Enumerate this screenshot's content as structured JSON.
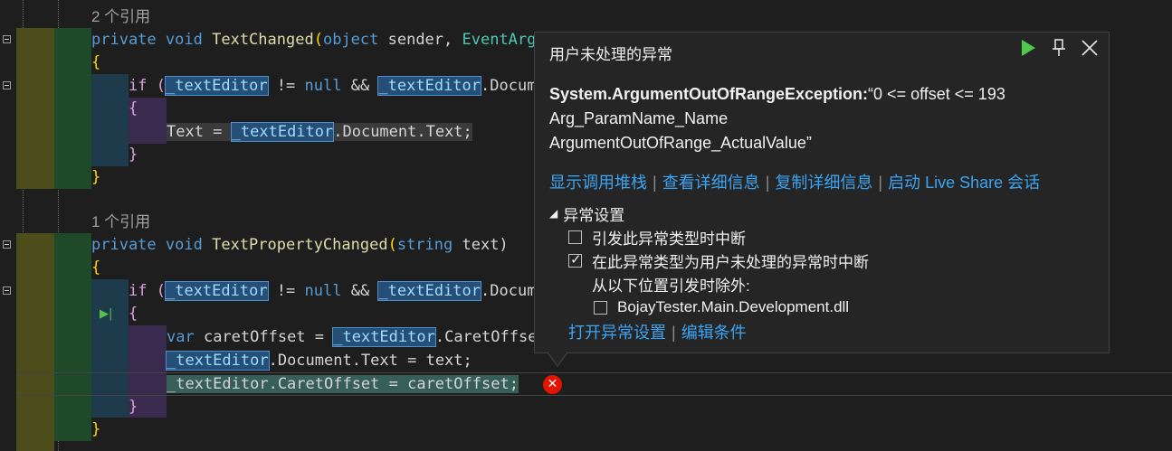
{
  "code": {
    "lines": [
      {
        "refs": "2 个引用"
      },
      {
        "sig1_kw1": "private",
        "sig1_kw2": "void",
        "sig1_fn": "TextChanged",
        "sig1_rest_a": "(",
        "sig1_kw3": "object",
        "sig1_rest_b": " sender, ",
        "sig1_type": "EventArg"
      },
      {
        "brace": "{"
      },
      {
        "if_kw": "if",
        "paren": " (",
        "ident": "_textEditor",
        "op": " != ",
        "null_kw": "null",
        "and": " && ",
        "ident2": "_textEditor",
        "tail": ".Docum"
      },
      {
        "brace": "{"
      },
      {
        "lhs": "Text = ",
        "ident": "_textEditor",
        "tail": ".Document.Text;"
      },
      {
        "brace": "}"
      },
      {
        "brace": "}"
      },
      {
        "refs": "1 个引用"
      },
      {
        "kw1": "private",
        "kw2": "void",
        "fn": "TextPropertyChanged",
        "p1": "(",
        "kw3": "string",
        "p2": " text)"
      },
      {
        "brace": "{"
      },
      {
        "if_kw": "if",
        "paren": " (",
        "ident": "_textEditor",
        "op": " != ",
        "null_kw": "null",
        "and": " && ",
        "ident2": "_textEditor",
        "tail": ".Docum"
      },
      {
        "brace": "{"
      },
      {
        "var_kw": "var",
        "mid": " caretOffset = ",
        "ident": "_textEditor",
        "tail": ".CaretOffse"
      },
      {
        "ident": "_textEditor",
        "tail": ".Document.Text = text;"
      },
      {
        "exec": "_textEditor.CaretOffset = caretOffset;"
      },
      {
        "brace": "}"
      },
      {
        "brace": "}"
      }
    ]
  },
  "popup": {
    "title": "用户未处理的异常",
    "exception_type": "System.ArgumentOutOfRangeException:",
    "message_line1": "“0 <= offset <= 193",
    "message_line2": "Arg_ParamName_Name",
    "message_line3": "ArgumentOutOfRange_ActualValue”",
    "links": [
      "显示调用堆栈",
      "查看详细信息",
      "复制详细信息",
      "启动 Live Share 会话"
    ],
    "settings_header": "异常设置",
    "settings": {
      "break_thrown": "引发此异常类型时中断",
      "break_user_unhandled": "在此异常类型为用户未处理的异常时中断",
      "except_when": "从以下位置引发时除外:",
      "module": "BojayTester.Main.Development.dll"
    },
    "footer_links": [
      "打开异常设置",
      "编辑条件"
    ]
  },
  "colors": {
    "background": "#1e1e1e",
    "keyword": "#569cd6",
    "control": "#d8a0df",
    "type": "#4ec9b0",
    "function": "#dcdcaa",
    "link": "#3ba4f2",
    "error": "#e51400"
  }
}
